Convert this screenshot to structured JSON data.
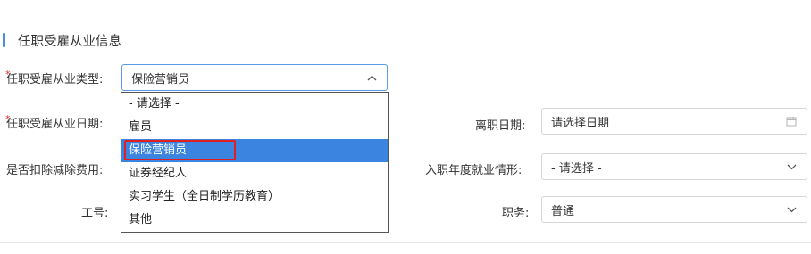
{
  "section": {
    "title": "任职受雇从业信息"
  },
  "rows": {
    "employment_type": {
      "label": "任职受雇从业类型:",
      "required": "*",
      "value": "保险营销员"
    },
    "employment_date": {
      "label": "任职受雇从业日期:",
      "required": "*"
    },
    "leave_date": {
      "label": "离职日期:",
      "placeholder": "请选择日期"
    },
    "deduct_fee": {
      "label": "是否扣除减除费用:"
    },
    "employment_status": {
      "label": "入职年度就业情形:",
      "value": "- 请选择 -"
    },
    "employee_id": {
      "label": "工号:"
    },
    "position": {
      "label": "职务:",
      "value": "普通"
    }
  },
  "dropdown": {
    "options": [
      "- 请选择 -",
      "雇员",
      "保险营销员",
      "证券经纪人",
      "实习学生（全日制学历教育）",
      "其他"
    ],
    "selected_index": 2
  },
  "colors": {
    "accent": "#3b85e0",
    "highlight_box": "#e02020",
    "section_bar": "#4a8de0"
  },
  "icons": {
    "chevron_up": "chevron-up-icon",
    "chevron_down": "chevron-down-icon",
    "calendar": "calendar-icon"
  }
}
